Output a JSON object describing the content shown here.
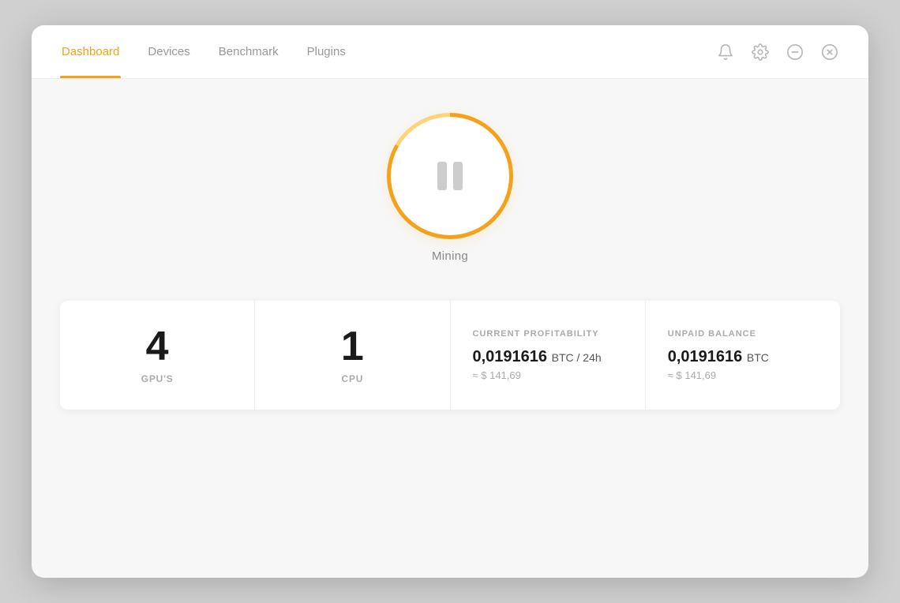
{
  "navbar": {
    "tabs": [
      {
        "id": "dashboard",
        "label": "Dashboard",
        "active": true
      },
      {
        "id": "devices",
        "label": "Devices",
        "active": false
      },
      {
        "id": "benchmark",
        "label": "Benchmark",
        "active": false
      },
      {
        "id": "plugins",
        "label": "Plugins",
        "active": false
      }
    ]
  },
  "controls": {
    "bell_label": "Notifications",
    "gear_label": "Settings",
    "minimize_label": "Minimize",
    "close_label": "Close"
  },
  "mining": {
    "button_label": "Mining",
    "status": "paused"
  },
  "stats": [
    {
      "id": "gpus",
      "value": "4",
      "label": "GPU'S"
    },
    {
      "id": "cpu",
      "value": "1",
      "label": "CPU"
    },
    {
      "id": "profitability",
      "heading": "CURRENT PROFITABILITY",
      "btc_value": "0,0191616",
      "btc_unit": "BTC / 24h",
      "usd_approx": "≈ $ 141,69"
    },
    {
      "id": "balance",
      "heading": "UNPAID BALANCE",
      "btc_value": "0,0191616",
      "btc_unit": "BTC",
      "usd_approx": "≈ $ 141,69"
    }
  ]
}
